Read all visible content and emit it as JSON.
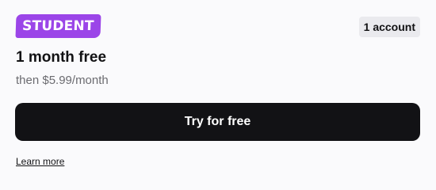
{
  "plan": {
    "badge_label": "STUDENT",
    "accounts_label": "1 account",
    "title": "1 month free",
    "subtitle": "then $5.99/month",
    "cta_label": "Try for free",
    "learn_more_label": "Learn more"
  },
  "colors": {
    "badge_bg": "#9b45e8",
    "cta_bg": "#121215",
    "accounts_bg": "#eaeaee",
    "page_bg": "#fafafc"
  }
}
